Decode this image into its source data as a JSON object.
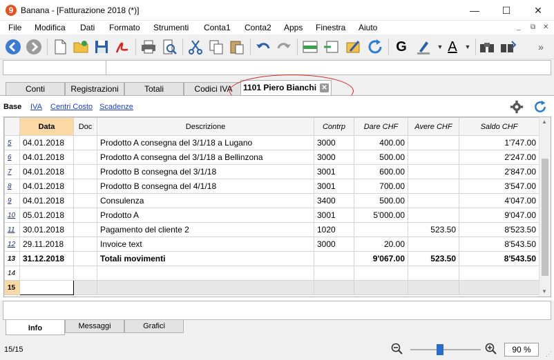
{
  "window": {
    "title": "Banana - [Fatturazione 2018 (*)]",
    "logo_char": "9",
    "controls": {
      "minimize": "—",
      "maximize": "☐",
      "close": "✕"
    }
  },
  "menu": {
    "items": [
      "File",
      "Modifica",
      "Dati",
      "Formato",
      "Strumenti",
      "Conta1",
      "Conta2",
      "Apps",
      "Finestra",
      "Aiuto"
    ],
    "mdi_controls": [
      "_",
      "⧉",
      "✕"
    ]
  },
  "toolbar": {
    "buttons": [
      "back-icon",
      "forward-icon",
      "new-document-icon",
      "open-folder-icon",
      "save-icon",
      "pdf-icon",
      "print-icon",
      "print-preview-icon",
      "cut-icon",
      "copy-icon",
      "paste-icon",
      "undo-icon",
      "redo-icon",
      "add-row-icon",
      "insert-row-icon",
      "edit-row-icon",
      "recalculate-icon",
      "bold-icon",
      "highlight-icon",
      "font-color-icon",
      "find-icon",
      "find-next-icon"
    ],
    "bold_label": "G",
    "font_color_label": "A",
    "more": "»"
  },
  "tabs": [
    {
      "label": "Conti",
      "active": false
    },
    {
      "label": "Registrazioni",
      "active": false
    },
    {
      "label": "Totali",
      "active": false
    },
    {
      "label": "Codici IVA",
      "active": false
    },
    {
      "label": "1101 Piero Bianchi",
      "active": true
    }
  ],
  "viewtabs": [
    "Base",
    "IVA",
    "Centri Costo",
    "Scadenze"
  ],
  "table": {
    "columns": [
      "Data",
      "Doc",
      "Descrizione",
      "Contrp",
      "Dare CHF",
      "Avere CHF",
      "Saldo CHF"
    ],
    "rows": [
      {
        "n": "5",
        "data": "04.01.2018",
        "doc": "",
        "descr": "Prodotto A consegna del 3/1/18 a Lugano",
        "contrp": "3000",
        "dare": "400.00",
        "avere": "",
        "saldo": "1'747.00"
      },
      {
        "n": "6",
        "data": "04.01.2018",
        "doc": "",
        "descr": "Prodotto A consegna del 3/1/18 a Bellinzona",
        "contrp": "3000",
        "dare": "500.00",
        "avere": "",
        "saldo": "2'247.00"
      },
      {
        "n": "7",
        "data": "04.01.2018",
        "doc": "",
        "descr": "Prodotto B consegna del 3/1/18",
        "contrp": "3001",
        "dare": "600.00",
        "avere": "",
        "saldo": "2'847.00"
      },
      {
        "n": "8",
        "data": "04.01.2018",
        "doc": "",
        "descr": "Prodotto B consegna del 4/1/18",
        "contrp": "3001",
        "dare": "700.00",
        "avere": "",
        "saldo": "3'547.00"
      },
      {
        "n": "9",
        "data": "04.01.2018",
        "doc": "",
        "descr": "Consulenza",
        "contrp": "3400",
        "dare": "500.00",
        "avere": "",
        "saldo": "4'047.00"
      },
      {
        "n": "10",
        "data": "05.01.2018",
        "doc": "",
        "descr": "Prodotto A",
        "contrp": "3001",
        "dare": "5'000.00",
        "avere": "",
        "saldo": "9'047.00"
      },
      {
        "n": "11",
        "data": "30.01.2018",
        "doc": "",
        "descr": "Pagamento del cliente 2",
        "contrp": "1020",
        "dare": "",
        "avere": "523.50",
        "saldo": "8'523.50"
      },
      {
        "n": "12",
        "data": "29.11.2018",
        "doc": "",
        "descr": "Invoice text",
        "contrp": "3000",
        "dare": "20.00",
        "avere": "",
        "saldo": "8'543.50"
      }
    ],
    "total": {
      "n": "13",
      "data": "31.12.2018",
      "doc": "",
      "descr": "Totali movimenti",
      "contrp": "",
      "dare": "9'067.00",
      "avere": "523.50",
      "saldo": "8'543.50"
    },
    "empty_rows": [
      "14",
      "15"
    ]
  },
  "bottom_tabs": [
    {
      "label": "Info",
      "active": true
    },
    {
      "label": "Messaggi",
      "active": false
    },
    {
      "label": "Grafici",
      "active": false
    }
  ],
  "status": {
    "count": "15/15",
    "zoom_value": "90 %",
    "zoom_level_fraction": 0.4
  }
}
